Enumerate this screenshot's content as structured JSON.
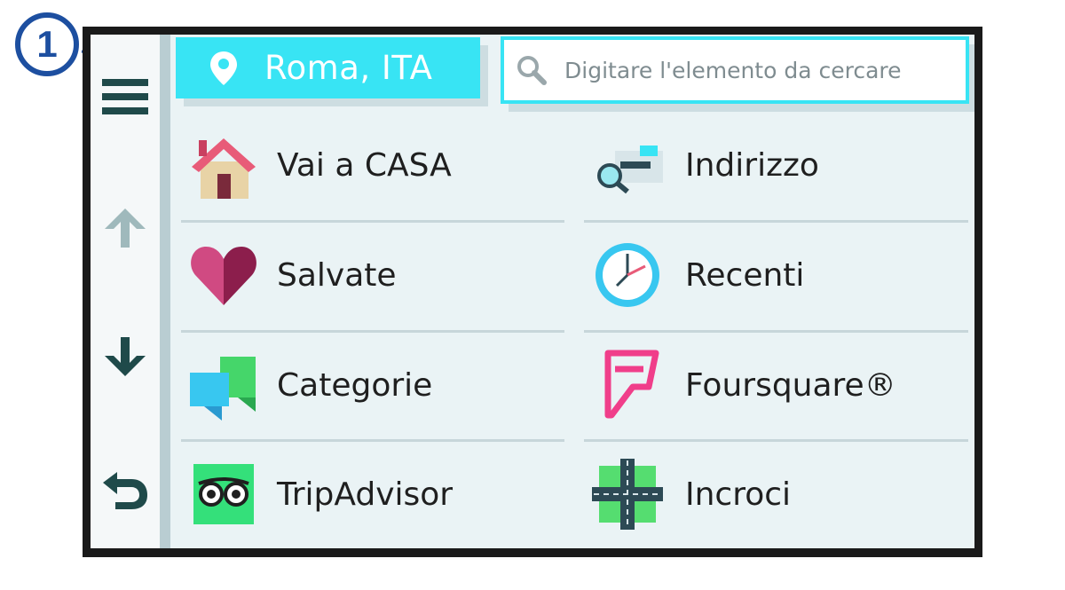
{
  "callout": {
    "number": "1"
  },
  "location": {
    "label": "Roma, ITA",
    "icon": "map-pin-icon"
  },
  "search": {
    "placeholder": "Digitare l'elemento da cercare",
    "icon": "search-icon"
  },
  "sidebar": {
    "items": [
      {
        "name": "menu",
        "icon": "hamburger-menu-icon"
      },
      {
        "name": "scroll-up",
        "icon": "arrow-up-icon",
        "disabled": true
      },
      {
        "name": "scroll-down",
        "icon": "arrow-down-icon"
      },
      {
        "name": "back",
        "icon": "back-arrow-icon"
      }
    ]
  },
  "grid": {
    "items": [
      {
        "label": "Vai a CASA",
        "icon": "home-icon"
      },
      {
        "label": "Indirizzo",
        "icon": "address-icon"
      },
      {
        "label": "Salvate",
        "icon": "heart-icon"
      },
      {
        "label": "Recenti",
        "icon": "clock-icon"
      },
      {
        "label": "Categorie",
        "icon": "categories-icon"
      },
      {
        "label": "Foursquare®",
        "icon": "foursquare-icon"
      },
      {
        "label": "TripAdvisor",
        "icon": "tripadvisor-icon"
      },
      {
        "label": "Incroci",
        "icon": "intersection-icon"
      }
    ]
  },
  "colors": {
    "accent": "#38e4f4",
    "background": "#eaf3f5",
    "frame": "#1a1a1a"
  }
}
